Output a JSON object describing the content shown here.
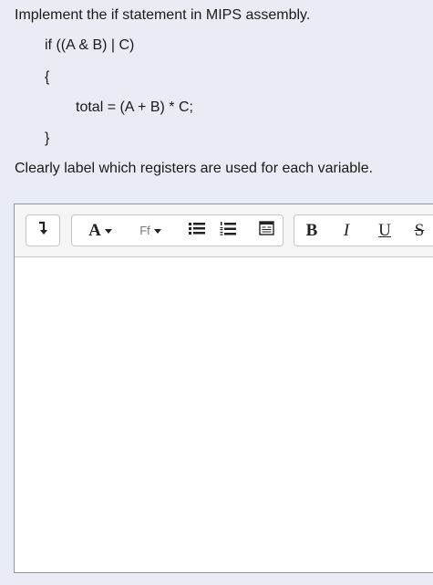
{
  "question": {
    "intro": "Implement the if statement in MIPS assembly.",
    "code": [
      "if ((A & B) | C)",
      "{",
      "total = (A + B) * C;",
      "}"
    ],
    "outro": "Clearly label which registers are used for each variable."
  },
  "editor": {
    "toolbar": {
      "paragraph_style_label": "A",
      "font_family_label": "Ff",
      "bold_label": "B",
      "italic_label": "I",
      "underline_label": "U",
      "strikethrough_label": "S"
    },
    "content": ""
  }
}
